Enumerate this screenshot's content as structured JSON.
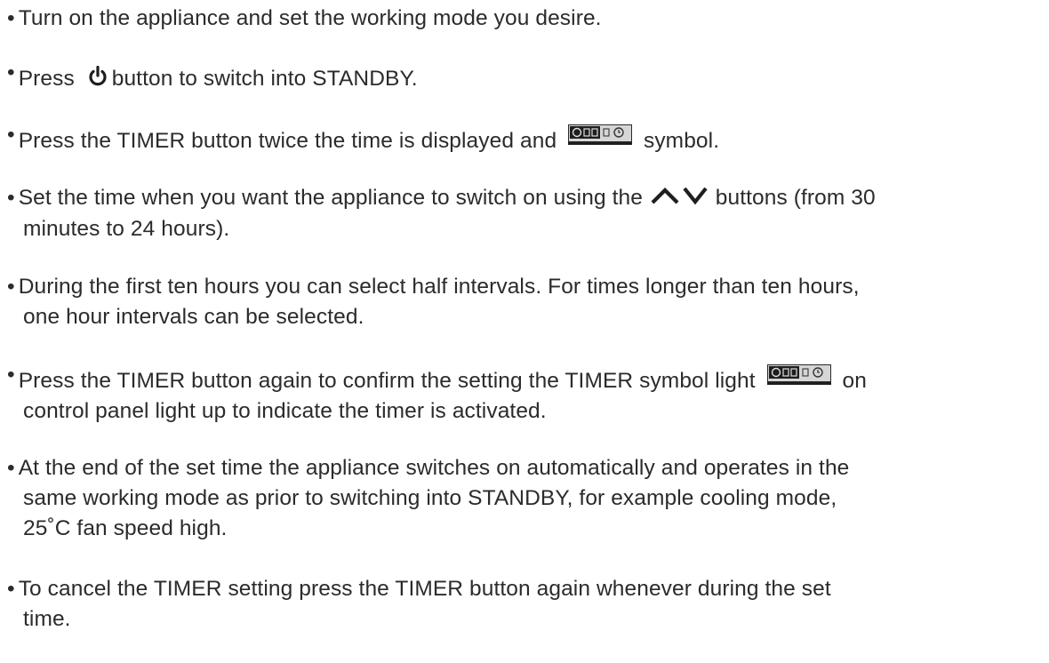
{
  "instructions": [
    {
      "text": "Turn on the appliance and set the working mode you desire."
    },
    {
      "before": "Press ",
      "icon": "power-icon",
      "after": "button to switch into STANDBY."
    },
    {
      "before": "Press the TIMER button twice the time is displayed and ",
      "icon": "timer-symbol-icon",
      "after": " symbol."
    },
    {
      "before": "Set the time when you want the appliance to switch on using the ",
      "icon": "up-down-arrow-icons",
      "after": " buttons (from 30",
      "line2": "minutes to 24 hours)."
    },
    {
      "text": "During the first ten hours you can select half intervals. For times longer than ten hours,",
      "line2": "one hour intervals can be selected."
    },
    {
      "before": "Press the TIMER button again to confirm the setting the TIMER symbol light ",
      "icon": "timer-symbol-icon",
      "after": " on",
      "line2": "control panel light up to indicate the timer is activated."
    },
    {
      "text": "At the end of the set time the appliance switches on automatically and operates in the",
      "line2": "same working mode as prior to switching into STANDBY, for example cooling mode,",
      "line3": "25˚C fan speed high."
    },
    {
      "text": "To cancel the TIMER setting press the TIMER button again whenever during the set",
      "line2": "time."
    }
  ],
  "bullet": "•"
}
